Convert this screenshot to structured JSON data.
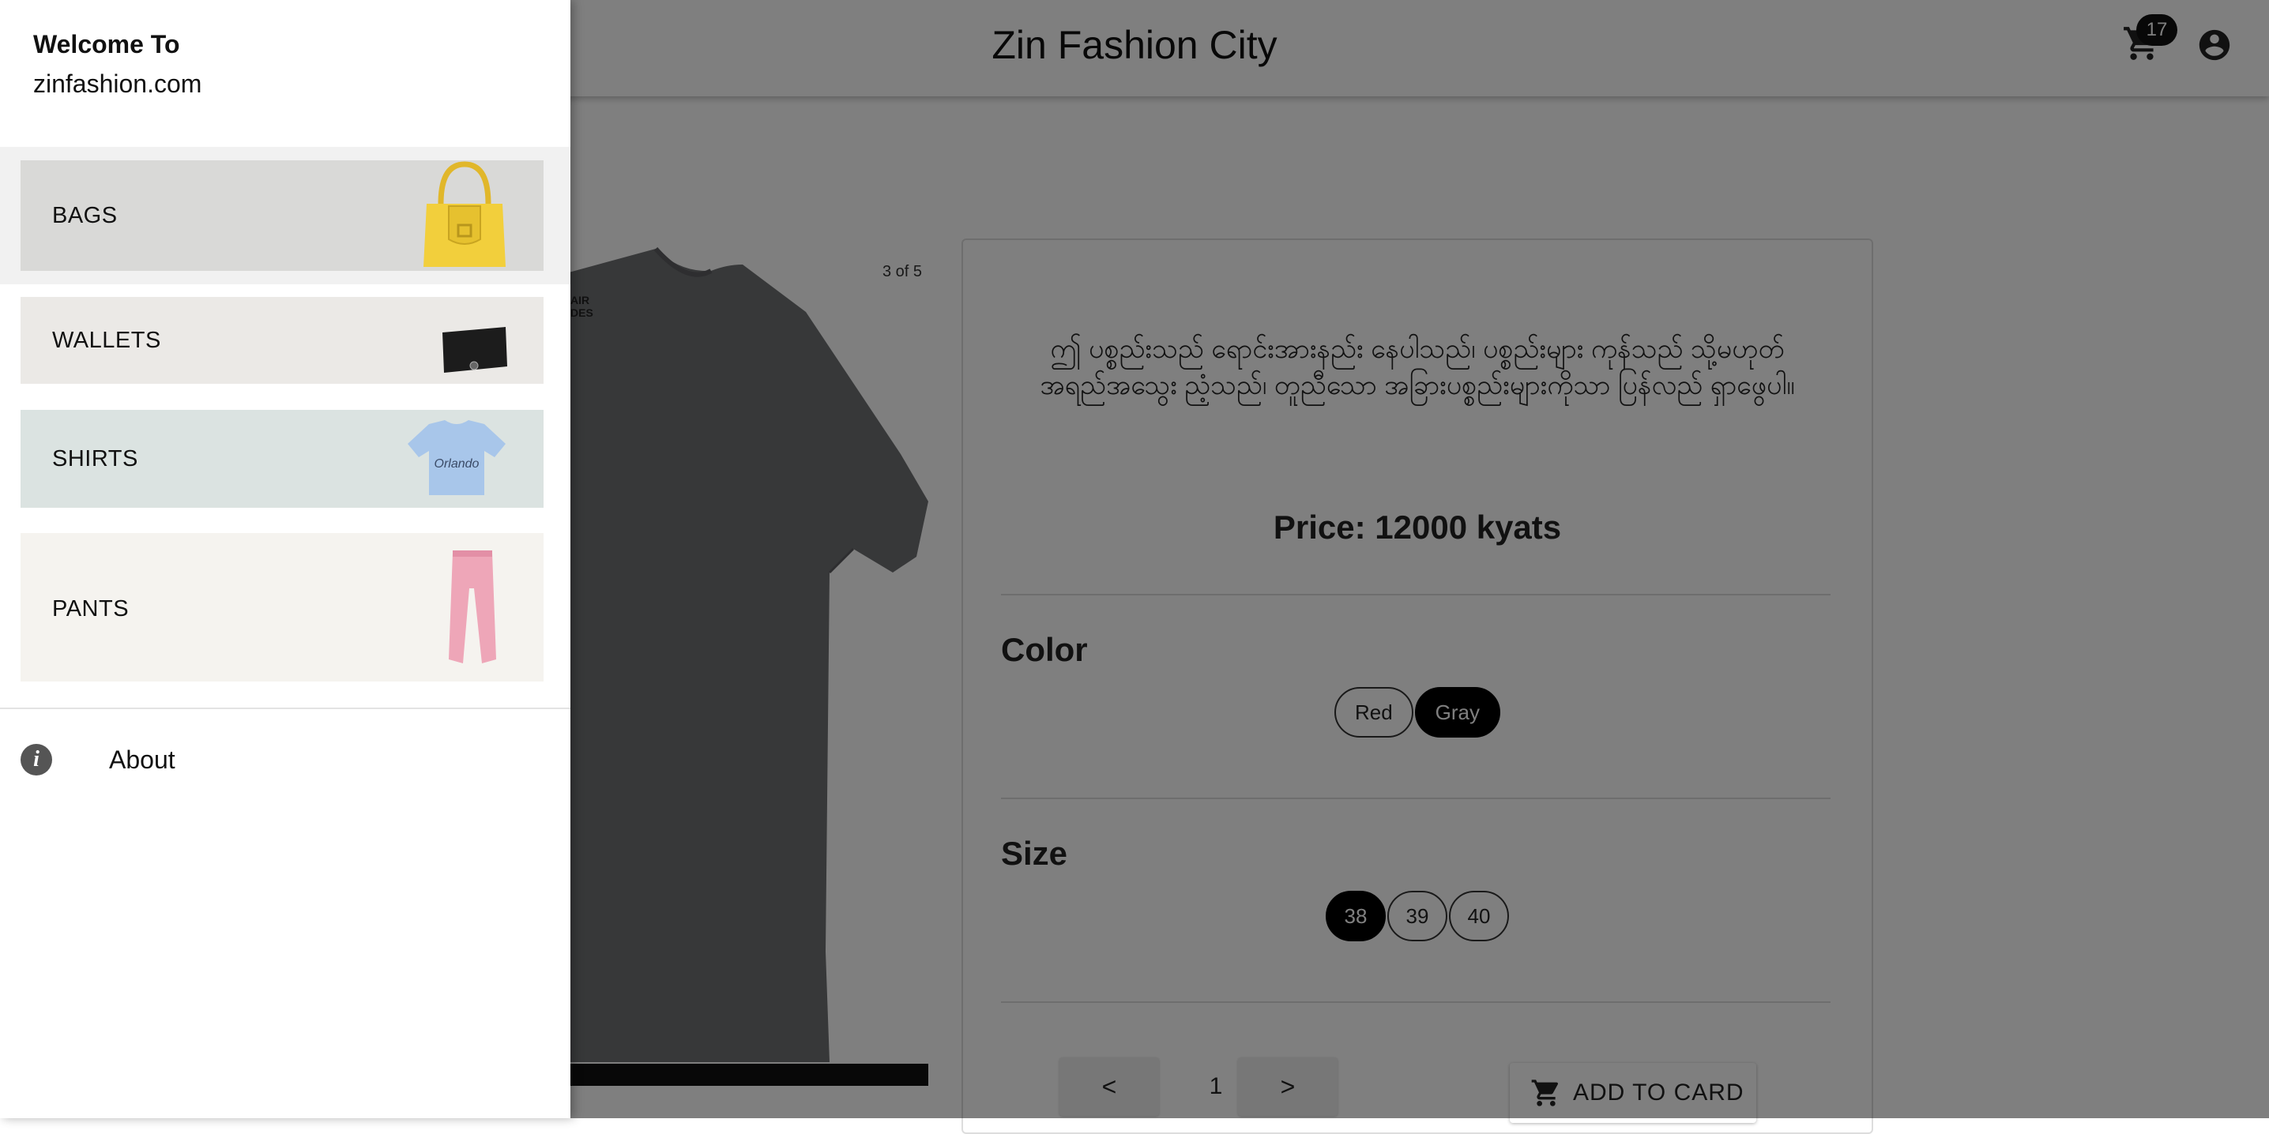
{
  "header": {
    "title": "Zin Fashion City",
    "cart_count": "17"
  },
  "product": {
    "image_counter": "3 of 5",
    "description": "ဤ ပစ္စည်းသည် ရောင်းအားနည်း နေပါသည်၊ ပစ္စည်းများ ကုန်သည် သို့မဟုတ် အရည်အသွေး ညံ့သည်၊ တူညီသော အခြားပစ္စည်းများကိုသာ ပြန်လည် ရှာဖွေပါ။",
    "price": "Price: 12000 kyats",
    "color_title": "Color",
    "colors": [
      "Red",
      "Gray"
    ],
    "selected_color": "Gray",
    "size_title": "Size",
    "sizes": [
      "38",
      "39",
      "40"
    ],
    "selected_size": "38",
    "pager": {
      "prev": "<",
      "page": "1",
      "next": ">"
    },
    "add_label": "ADD TO CARD"
  },
  "drawer": {
    "welcome": "Welcome To",
    "site": "zinfashion.com",
    "categories": [
      {
        "label": "BAGS",
        "bg": "#d9d9d7"
      },
      {
        "label": "WALLETS",
        "bg": "#ebe9e6"
      },
      {
        "label": "SHIRTS",
        "bg": "#dbe3e1"
      },
      {
        "label": "PANTS",
        "bg": "#f5f3ef"
      }
    ],
    "about": "About"
  },
  "colors": {
    "accent": "#000000",
    "overlay": "rgba(0,0,0,0.5)"
  }
}
